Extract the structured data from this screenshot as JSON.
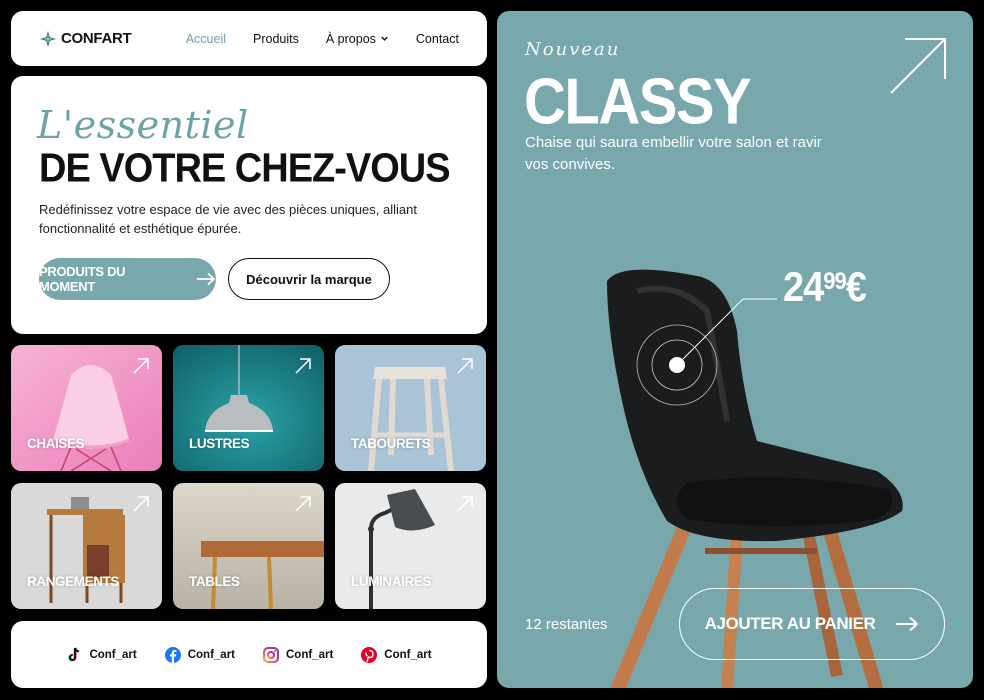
{
  "brand": {
    "name": "CONFART"
  },
  "nav": {
    "items": [
      {
        "label": "Accueil",
        "active": true
      },
      {
        "label": "Produits"
      },
      {
        "label": "À propos",
        "has_dropdown": true
      },
      {
        "label": "Contact"
      }
    ]
  },
  "hero": {
    "script": "L'essentiel",
    "title": "DE VOTRE CHEZ-VOUS",
    "description": "Redéfinissez votre espace de vie avec des pièces uniques, alliant fonctionnalité et esthétique épurée.",
    "primary_button": "PRODUITS DU MOMENT",
    "secondary_button": "Découvrir la marque"
  },
  "categories": [
    {
      "label": "CHAISES",
      "color": "#f29ac8"
    },
    {
      "label": "LUSTRES",
      "color": "#1d8a90"
    },
    {
      "label": "TABOURETS",
      "color": "#9fbcd0"
    },
    {
      "label": "RANGEMENTS",
      "color": "#d8d8d6"
    },
    {
      "label": "TABLES",
      "color": "#c9c2b6"
    },
    {
      "label": "LUMINAIRES",
      "color": "#e6e8e9"
    }
  ],
  "social": [
    {
      "network": "tiktok-icon",
      "handle": "Conf_art"
    },
    {
      "network": "facebook-icon",
      "handle": "Conf_art"
    },
    {
      "network": "instagram-icon",
      "handle": "Conf_art"
    },
    {
      "network": "pinterest-icon",
      "handle": "Conf_art"
    }
  ],
  "product": {
    "kicker": "Nouveau",
    "name": "CLASSY",
    "description": "Chaise qui saura embellir votre salon et ravir vos convives.",
    "price_main": "24",
    "price_cents": "99",
    "currency": "€",
    "stock": "12 restantes",
    "cta": "AJOUTER AU PANIER",
    "background": "#78a8ab"
  },
  "colors": {
    "accent": "#78a8ab",
    "accent_text": "#6ea3a6"
  }
}
